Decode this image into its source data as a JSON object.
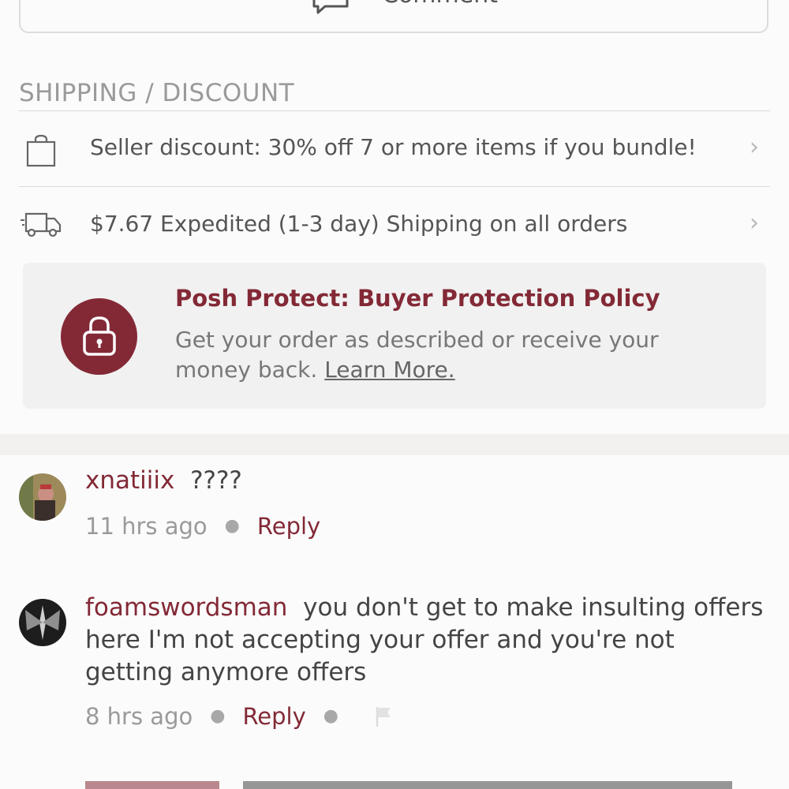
{
  "comment_button": {
    "label": "Comment",
    "icon": "speech-bubble-icon"
  },
  "shipping_section": {
    "title": "SHIPPING / DISCOUNT",
    "rows": [
      {
        "icon": "shopping-bag-icon",
        "text": "Seller discount: 30% off 7 or more items if you bundle!"
      },
      {
        "icon": "delivery-truck-icon",
        "text": "$7.67 Expedited (1-3 day) Shipping on all orders"
      }
    ]
  },
  "posh_protect": {
    "icon": "lock-icon",
    "title": "Posh Protect: Buyer Protection Policy",
    "body": "Get your order as described or receive your money back. ",
    "link": "Learn More."
  },
  "comments": [
    {
      "username": "xnatiiix",
      "text": "????",
      "time": "11 hrs ago",
      "reply_label": "Reply"
    },
    {
      "username": "foamswordsman",
      "text": "you don't get to make insulting offers here I'm not accepting your offer and you're not getting anymore offers",
      "time": "8 hrs ago",
      "reply_label": "Reply",
      "flag_icon": "flag-icon"
    }
  ],
  "colors": {
    "accent": "#832936",
    "muted_text": "#9a9a9a",
    "card_bg": "#f1f1f1"
  }
}
